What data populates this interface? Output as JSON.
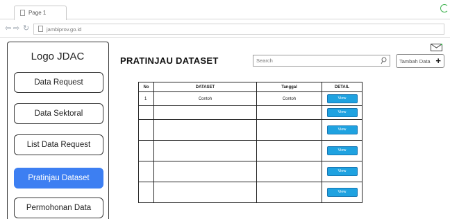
{
  "browser": {
    "tab_title": "Page 1",
    "url": "jambiprov.go.id"
  },
  "sidebar": {
    "logo": "Logo JDAC",
    "items": [
      {
        "label": "Data Request"
      },
      {
        "label": "Data Sektoral"
      },
      {
        "label": "List Data Request"
      },
      {
        "label": "Pratinjau Dataset",
        "active": true
      },
      {
        "label": "Permohonan Data"
      }
    ]
  },
  "main": {
    "title": "PRATINJAU DATASET",
    "search_placeholder": "Search",
    "add_button_label": "Tambah Data"
  },
  "table": {
    "headers": [
      "No",
      "DATASET",
      "Tanggal",
      "DETAIL"
    ],
    "rows": [
      {
        "no": "1",
        "dataset": "Contoh",
        "tanggal": "Contoh",
        "detail": "View"
      },
      {
        "no": "",
        "dataset": "",
        "tanggal": "",
        "detail": "View"
      },
      {
        "no": "",
        "dataset": "",
        "tanggal": "",
        "detail": "View"
      },
      {
        "no": "",
        "dataset": "",
        "tanggal": "",
        "detail": "View"
      },
      {
        "no": "",
        "dataset": "",
        "tanggal": "",
        "detail": "View"
      },
      {
        "no": "",
        "dataset": "",
        "tanggal": "",
        "detail": "View"
      }
    ]
  },
  "colors": {
    "active_menu": "#3d7ff2",
    "view_button": "#1fa2e0"
  }
}
